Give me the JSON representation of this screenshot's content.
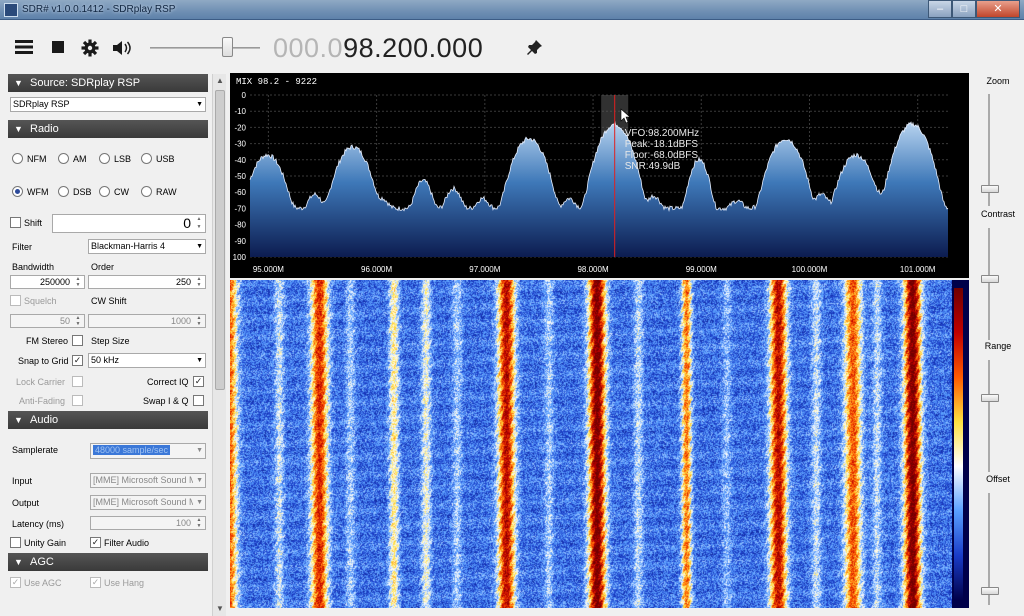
{
  "window": {
    "title": "SDR# v1.0.0.1412 - SDRplay RSP",
    "minimize": "–",
    "maximize": "□",
    "close": "✕"
  },
  "toolbar": {
    "menu_icon": "hamburger-icon",
    "stop_icon": "stop-icon",
    "settings_icon": "gear-icon",
    "audio_icon": "speaker-icon",
    "frequency_dim": "000.0",
    "frequency_lit": "98.200.000",
    "pin_icon": "pin-icon"
  },
  "source": {
    "header": "Source: SDRplay RSP",
    "device": "SDRplay RSP"
  },
  "radio": {
    "header": "Radio",
    "modes": [
      "NFM",
      "AM",
      "LSB",
      "USB",
      "WFM",
      "DSB",
      "CW",
      "RAW"
    ],
    "selected_mode": "WFM",
    "shift_label": "Shift",
    "shift_value": "0",
    "filter_label": "Filter",
    "filter_value": "Blackman-Harris 4",
    "bandwidth_label": "Bandwidth",
    "bandwidth_value": "250000",
    "order_label": "Order",
    "order_value": "250",
    "squelch_label": "Squelch",
    "squelch_value": "50",
    "cw_shift_label": "CW Shift",
    "cw_shift_value": "1000",
    "fm_stereo_label": "FM Stereo",
    "step_size_label": "Step Size",
    "snap_label": "Snap to Grid",
    "step_value": "50 kHz",
    "lock_carrier_label": "Lock Carrier",
    "correct_iq_label": "Correct IQ",
    "anti_fading_label": "Anti-Fading",
    "swap_iq_label": "Swap I & Q"
  },
  "audio": {
    "header": "Audio",
    "samplerate_label": "Samplerate",
    "samplerate_value": "48000 sample/sec",
    "input_label": "Input",
    "input_value": "[MME] Microsoft Sound Mapper - Input",
    "output_label": "Output",
    "output_value": "[MME] Microsoft Sound Mapper - Output",
    "latency_label": "Latency (ms)",
    "latency_value": "100",
    "unity_gain_label": "Unity Gain",
    "filter_audio_label": "Filter Audio"
  },
  "agc": {
    "header": "AGC",
    "use_agc_label": "Use AGC",
    "use_hang_label": "Use Hang"
  },
  "spectrum": {
    "title": "MIX 98.2 - 9222",
    "y_ticks": [
      "0",
      "-10",
      "-20",
      "-30",
      "-40",
      "-50",
      "-60",
      "-70",
      "-80",
      "-90",
      "100"
    ],
    "x_ticks": [
      "95.000M",
      "96.000M",
      "97.000M",
      "98.000M",
      "99.000M",
      "100.000M",
      "101.000M"
    ],
    "vfo_text": "VFO:98.200MHz",
    "peak_text": "Peak:-18.1dBFS",
    "floor_text": "Floor:-68.0dBFS",
    "snr_text": "SNR:49.9dB",
    "x_range_mhz": [
      94.83,
      101.28
    ],
    "y_range_db": [
      0,
      -100
    ],
    "vfo_mhz": 98.2,
    "filter_bandwidth_hz": 250000,
    "peaks": [
      {
        "mhz": 94.99,
        "db": -37
      },
      {
        "mhz": 95.43,
        "db": -62
      },
      {
        "mhz": 95.78,
        "db": -32
      },
      {
        "mhz": 96.05,
        "db": -65
      },
      {
        "mhz": 96.43,
        "db": -53
      },
      {
        "mhz": 96.71,
        "db": -58
      },
      {
        "mhz": 96.98,
        "db": -65
      },
      {
        "mhz": 97.41,
        "db": -27
      },
      {
        "mhz": 97.78,
        "db": -65
      },
      {
        "mhz": 98.2,
        "db": -18
      },
      {
        "mhz": 98.56,
        "db": -63
      },
      {
        "mhz": 98.98,
        "db": -40
      },
      {
        "mhz": 99.33,
        "db": -67
      },
      {
        "mhz": 99.78,
        "db": -27
      },
      {
        "mhz": 100.11,
        "db": -62
      },
      {
        "mhz": 100.43,
        "db": -37
      },
      {
        "mhz": 100.64,
        "db": -63
      },
      {
        "mhz": 100.95,
        "db": -18
      }
    ],
    "noise_floor_db": -70
  },
  "waterfall": {
    "colormap": [
      "#00004a",
      "#1a3cc8",
      "#5aa0ff",
      "#ffffff",
      "#ffe040",
      "#ff5a00",
      "#c00000",
      "#700000"
    ]
  },
  "right_panel": {
    "zoom_label": "Zoom",
    "contrast_label": "Contrast",
    "range_label": "Range",
    "offset_label": "Offset"
  }
}
